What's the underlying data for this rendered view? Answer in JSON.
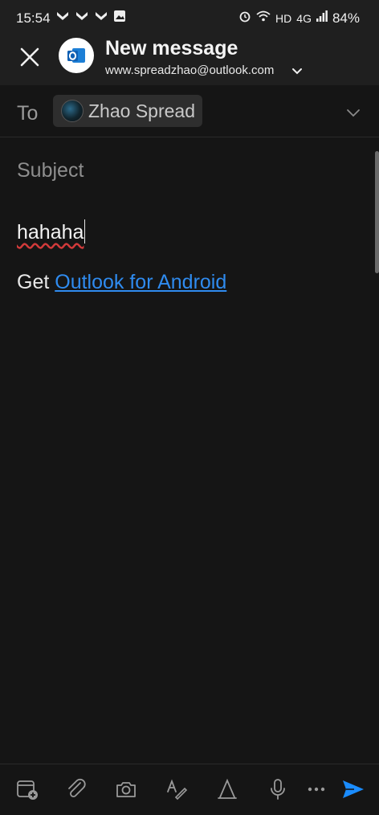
{
  "status_bar": {
    "time": "15:54",
    "network": "HD",
    "signal": "4G",
    "battery": "84%",
    "icons": [
      "notification-icon",
      "notification-icon",
      "notification-icon",
      "gallery-icon",
      "alarm-icon",
      "wifi-icon",
      "signal-icon",
      "battery-icon"
    ]
  },
  "header": {
    "title": "New message",
    "account": "www.spreadzhao@outlook.com"
  },
  "to": {
    "label": "To",
    "recipient": "Zhao Spread"
  },
  "subject": {
    "placeholder": "Subject"
  },
  "body": {
    "text": "hahaha",
    "signature_prefix": "Get ",
    "signature_link": "Outlook for Android"
  },
  "toolbar": {
    "icons": [
      "calendar-add-icon",
      "attach-icon",
      "camera-icon",
      "text-format-icon",
      "ink-icon",
      "microphone-icon",
      "more-icon",
      "send-icon"
    ]
  },
  "colors": {
    "background": "#151515",
    "header": "#1f1f1f",
    "link": "#2f8bef",
    "send": "#1a8cff"
  }
}
